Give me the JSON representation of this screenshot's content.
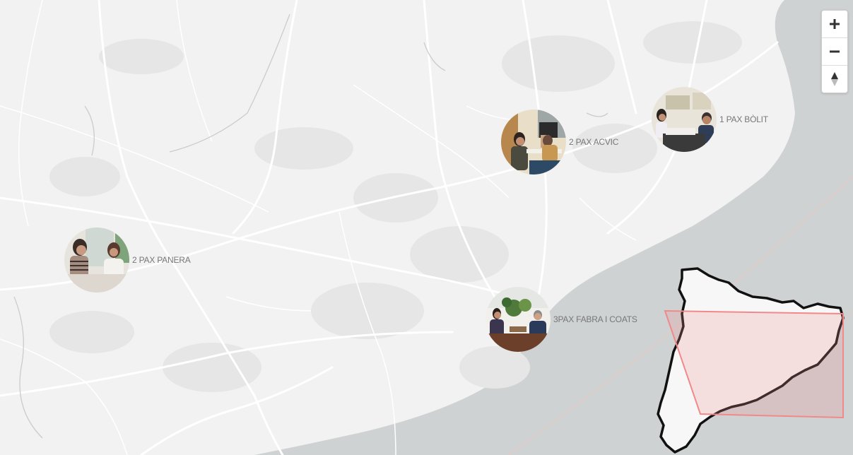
{
  "map": {
    "colors": {
      "land": "#f2f2f2",
      "sea": "#cfd2d3",
      "roads": "#ffffff",
      "urban": "#e6e6e6",
      "label_text": "#777777",
      "inset_highlight": "#f08a8a"
    },
    "controls": {
      "zoom_in": {
        "icon": "plus-icon"
      },
      "zoom_out": {
        "icon": "minus-icon"
      },
      "compass": {
        "icon": "compass-north-icon"
      }
    },
    "markers": [
      {
        "label": "2 PAX PANERA",
        "photo": "two women talking at a table"
      },
      {
        "label": "2 PAX ACVIC",
        "photo": "two women seated at a desk in an office"
      },
      {
        "label": "1 PAX BÒLIT",
        "photo": "a woman and a man meeting in a gallery"
      },
      {
        "label": "3PAX FABRA I COATS",
        "photo": "three people seated among plants in a lounge"
      }
    ],
    "inset": {
      "name": "Catalonia overview map"
    }
  }
}
